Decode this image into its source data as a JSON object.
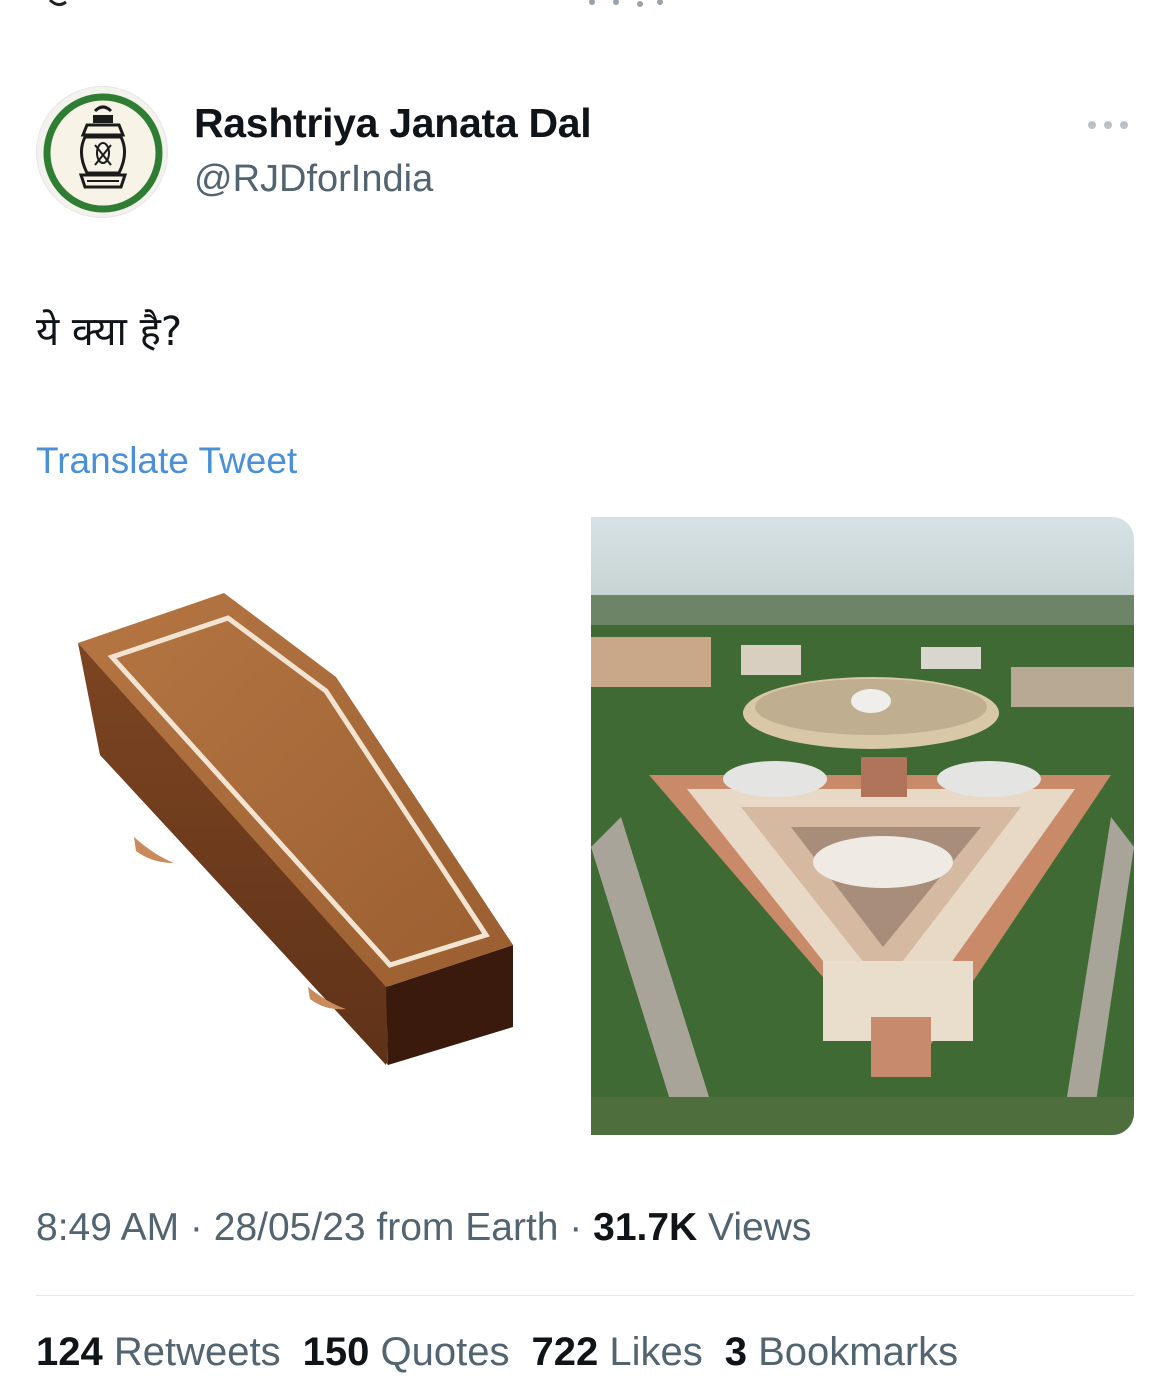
{
  "author": {
    "name": "Rashtriya Janata Dal",
    "handle": "@RJDforIndia"
  },
  "tweet": {
    "text": "ये क्या है?",
    "translate_label": "Translate Tweet"
  },
  "meta": {
    "time": "8:49 AM",
    "sep1": " · ",
    "date": "28/05/23",
    "source": " from Earth",
    "sep2": " · ",
    "views_count": "31.7K",
    "views_label": " Views"
  },
  "stats": [
    {
      "count": "124",
      "label": "Retweets"
    },
    {
      "count": "150",
      "label": "Quotes"
    },
    {
      "count": "722",
      "label": "Likes"
    },
    {
      "count": "3",
      "label": "Bookmarks"
    }
  ],
  "icons": {
    "avatar": "lantern-logo-icon",
    "more": "more-options-icon"
  },
  "colors": {
    "link": "#4a90d9",
    "secondary_text": "#536471",
    "logo_ring": "#2e7d32"
  }
}
